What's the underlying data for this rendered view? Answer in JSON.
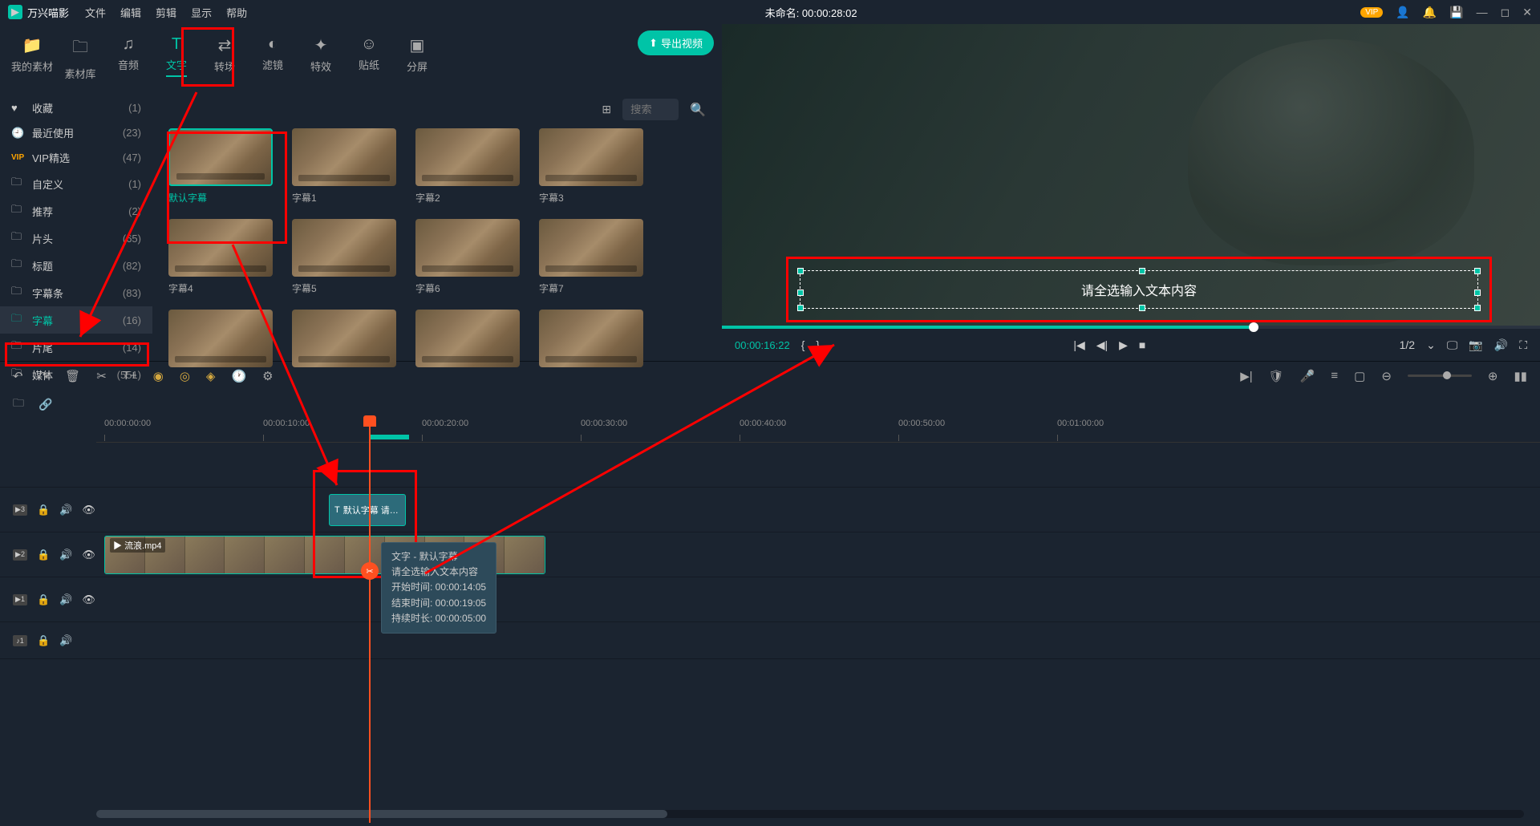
{
  "app": {
    "name": "万兴喵影",
    "title_center": "未命名: 00:00:28:02"
  },
  "menus": [
    "文件",
    "编辑",
    "剪辑",
    "显示",
    "帮助"
  ],
  "vip_badge": "VIP",
  "tabs": [
    {
      "label": "我的素材",
      "icon": "📁"
    },
    {
      "label": "素材库",
      "icon": "🗀"
    },
    {
      "label": "音频",
      "icon": "♫"
    },
    {
      "label": "文字",
      "icon": "T",
      "active": true
    },
    {
      "label": "转场",
      "icon": "⇄"
    },
    {
      "label": "滤镜",
      "icon": "◐"
    },
    {
      "label": "特效",
      "icon": "✦"
    },
    {
      "label": "贴纸",
      "icon": "☺"
    },
    {
      "label": "分屏",
      "icon": "▣"
    }
  ],
  "export_label": "导出视频",
  "sidebar": [
    {
      "icon": "♥",
      "label": "收藏",
      "count": "(1)"
    },
    {
      "icon": "🕘",
      "label": "最近使用",
      "count": "(23)"
    },
    {
      "icon": "VIP",
      "label": "VIP精选",
      "count": "(47)",
      "vip": true
    },
    {
      "icon": "🗀",
      "label": "自定义",
      "count": "(1)"
    },
    {
      "icon": "🗀",
      "label": "推荐",
      "count": "(2)"
    },
    {
      "icon": "🗀",
      "label": "片头",
      "count": "(65)"
    },
    {
      "icon": "🗀",
      "label": "标题",
      "count": "(82)"
    },
    {
      "icon": "🗀",
      "label": "字幕条",
      "count": "(83)"
    },
    {
      "icon": "🗀",
      "label": "字幕",
      "count": "(16)",
      "selected": true
    },
    {
      "icon": "🗀",
      "label": "片尾",
      "count": "(14)"
    },
    {
      "icon": "🗀",
      "label": "媒体",
      "count": "(551)"
    }
  ],
  "search_placeholder": "搜索",
  "thumbs": [
    {
      "label": "默认字幕",
      "selected": true
    },
    {
      "label": "字幕1"
    },
    {
      "label": "字幕2"
    },
    {
      "label": "字幕3"
    },
    {
      "label": "字幕4"
    },
    {
      "label": "字幕5"
    },
    {
      "label": "字幕6"
    },
    {
      "label": "字幕7"
    },
    {
      "label": ""
    },
    {
      "label": ""
    },
    {
      "label": ""
    },
    {
      "label": ""
    }
  ],
  "preview": {
    "overlay_text": "请全选输入文本内容",
    "time": "00:00:16:22",
    "ratio": "1/2"
  },
  "ruler": [
    "00:00:00:00",
    "00:00:10:00",
    "00:00:20:00",
    "00:00:30:00",
    "00:00:40:00",
    "00:00:50:00",
    "00:01:00:00"
  ],
  "tracks": {
    "text_clip_label": "默认字幕 请…",
    "video_clip_label": "流浪.mp4",
    "t3": "▶3",
    "t2": "▶2",
    "t1": "▶1",
    "a1": "♪1"
  },
  "tooltip": {
    "line1": "文字 - 默认字幕",
    "line2": "请全选输入文本内容",
    "line3": "开始时间: 00:00:14:05",
    "line4": "结束时间: 00:00:19:05",
    "line5": "持续时长: 00:00:05:00"
  }
}
